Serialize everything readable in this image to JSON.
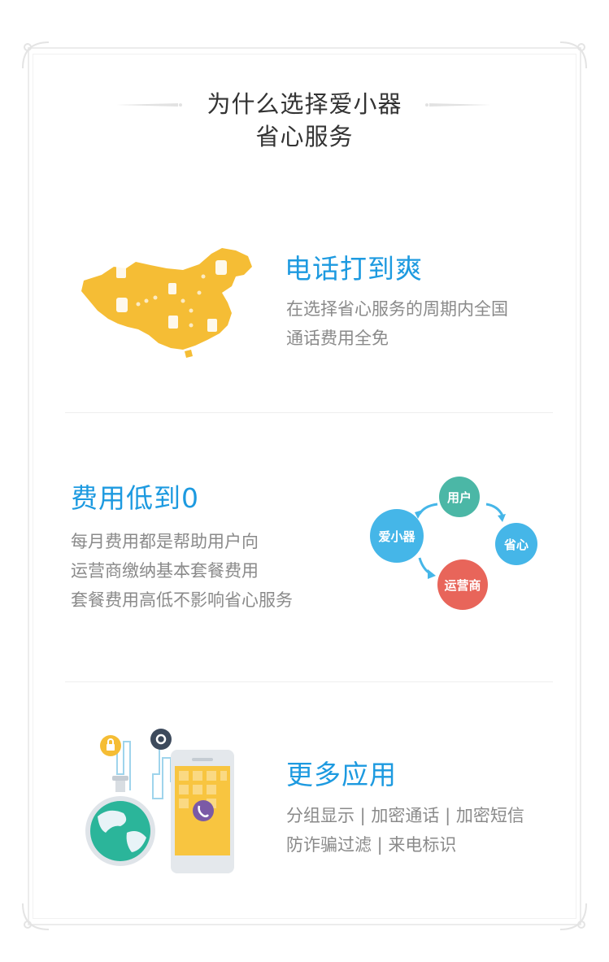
{
  "header": {
    "title_line1": "为什么选择爱小器",
    "title_line2": "省心服务"
  },
  "sections": [
    {
      "title": "电话打到爽",
      "desc": [
        "在选择省心服务的周期内全国",
        "通话费用全免"
      ]
    },
    {
      "title": "费用低到0",
      "desc": [
        "每月费用都是帮助用户向",
        "运营商缴纳基本套餐费用",
        "套餐费用高低不影响省心服务"
      ]
    },
    {
      "title": "更多应用",
      "desc": [
        "分组显示 | 加密通话 | 加密短信",
        "防诈骗过滤 | 来电标识"
      ]
    }
  ],
  "cycle": {
    "user": "用户",
    "aixiaoqi": "爱小器",
    "shengxin": "省心",
    "operator": "运营商"
  },
  "colors": {
    "accent": "#1d9ae0",
    "map": "#f5bd35",
    "user_bubble": "#4bb7a6",
    "aixiaoqi_bubble": "#45b6e8",
    "shengxin_bubble": "#45b6e8",
    "operator_bubble": "#e8655a"
  }
}
